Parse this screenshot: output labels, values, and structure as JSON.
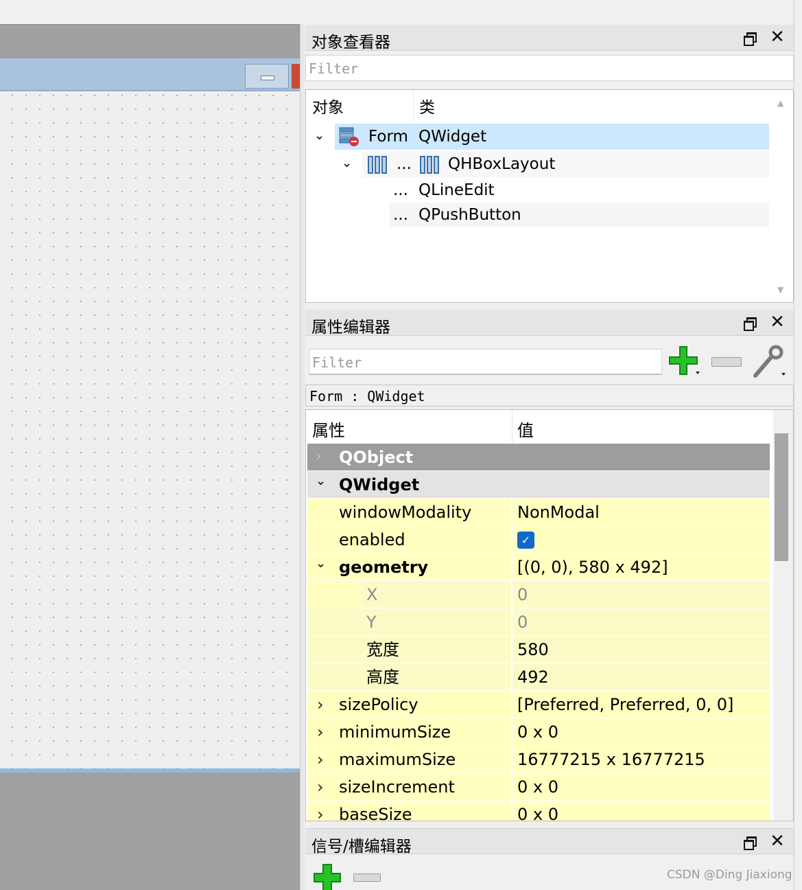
{
  "object_inspector": {
    "title": "对象查看器",
    "filter_placeholder": "Filter",
    "col_object": "对象",
    "col_class": "类",
    "rows": [
      {
        "object": "Form",
        "class": "QWidget"
      },
      {
        "object": "...",
        "class": "QHBoxLayout"
      },
      {
        "object": "...",
        "class": "QLineEdit"
      },
      {
        "object": "...",
        "class": "QPushButton"
      }
    ]
  },
  "property_editor": {
    "title": "属性编辑器",
    "filter_placeholder": "Filter",
    "current_object": "Form : QWidget",
    "col_property": "属性",
    "col_value": "值",
    "groups": {
      "qobject": "QObject",
      "qwidget": "QWidget"
    },
    "properties": [
      {
        "name": "windowModality",
        "value": "NonModal"
      },
      {
        "name": "enabled",
        "value": ""
      },
      {
        "name": "geometry",
        "value": "[(0, 0), 580 x 492]"
      },
      {
        "name": "X",
        "value": "0"
      },
      {
        "name": "Y",
        "value": "0"
      },
      {
        "name": "宽度",
        "value": "580"
      },
      {
        "name": "高度",
        "value": "492"
      },
      {
        "name": "sizePolicy",
        "value": "[Preferred, Preferred, 0, 0]"
      },
      {
        "name": "minimumSize",
        "value": "0 x 0"
      },
      {
        "name": "maximumSize",
        "value": "16777215 x 16777215"
      },
      {
        "name": "sizeIncrement",
        "value": "0 x 0"
      },
      {
        "name": "baseSize",
        "value": "0 x 0"
      }
    ],
    "enabled_checked": true
  },
  "signal_slot_editor": {
    "title": "信号/槽编辑器"
  },
  "watermark": "CSDN @Ding Jiaxiong",
  "colors": {
    "selection": "#cce8ff",
    "property_bg": "#ffffc0",
    "group_header": "#9d9d9d",
    "add_icon": "#27c227"
  }
}
